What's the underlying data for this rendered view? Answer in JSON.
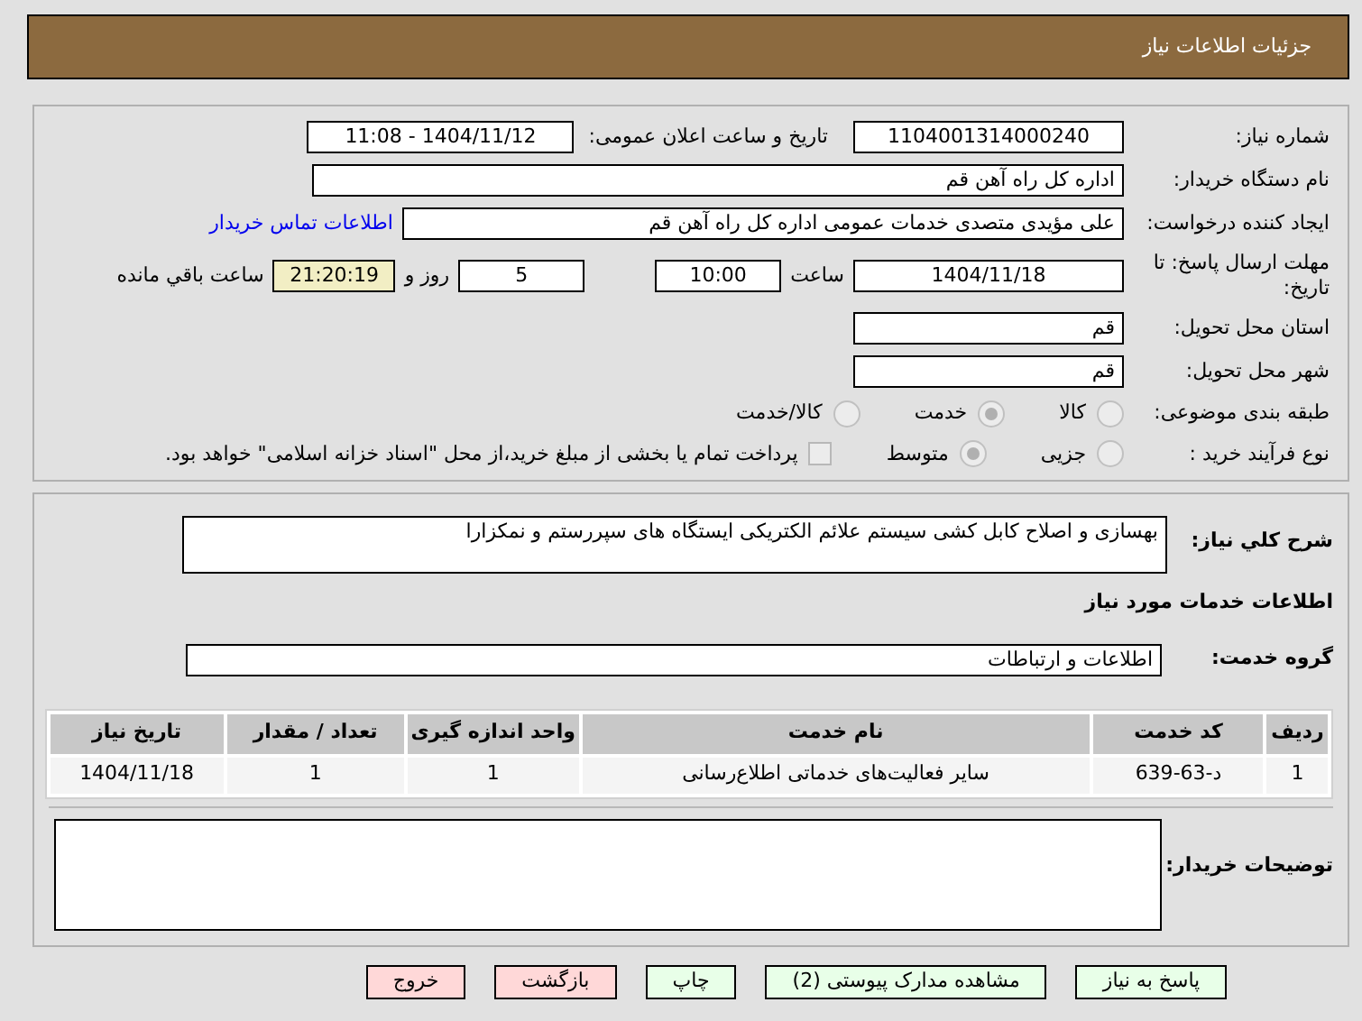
{
  "header": {
    "title": "جزئیات اطلاعات نیاز"
  },
  "fields": {
    "need_number": {
      "label": "شماره نیاز:",
      "value": "1104001314000240"
    },
    "announce": {
      "label": "تاریخ و ساعت اعلان عمومی:",
      "value": "1404/11/12 - 11:08"
    },
    "buyer": {
      "label": "نام دستگاه خریدار:",
      "value": "اداره کل  راه آهن قم"
    },
    "creator": {
      "label": "ایجاد کننده درخواست:",
      "value": "علی مؤیدی متصدی خدمات عمومی اداره کل  راه آهن قم",
      "link": "اطلاعات تماس خریدار"
    },
    "deadline": {
      "label": "مهلت ارسال پاسخ: تا تاریخ:",
      "date": "1404/11/18",
      "time_label": "ساعت",
      "time": "10:00",
      "days": "5",
      "days_label": "روز و",
      "remaining": "21:20:19",
      "remaining_label": "ساعت باقي مانده"
    },
    "province": {
      "label": "استان محل تحویل:",
      "value": "قم"
    },
    "city": {
      "label": "شهر محل تحویل:",
      "value": "قم"
    }
  },
  "category": {
    "label": "طبقه بندی موضوعی:",
    "options": [
      {
        "label": "کالا",
        "selected": false
      },
      {
        "label": "خدمت",
        "selected": true
      },
      {
        "label": "کالا/خدمت",
        "selected": false
      }
    ]
  },
  "process": {
    "label": "نوع فرآیند خرید :",
    "options": [
      {
        "label": "جزیی",
        "selected": false
      },
      {
        "label": "متوسط",
        "selected": true
      }
    ],
    "checkbox": {
      "checked": false,
      "label": "پرداخت تمام یا بخشی از مبلغ خرید،از محل \"اسناد خزانه اسلامی\" خواهد بود."
    }
  },
  "description": {
    "label": "شرح کلي نیاز:",
    "value": "بهسازی و اصلاح کابل کشی سیستم علائم الکتریکی ایستگاه های سپررستم و نمکزارا"
  },
  "services_title": "اطلاعات خدمات مورد نیاز",
  "service_group": {
    "label": "گروه خدمت:",
    "value": "اطلاعات و ارتباطات"
  },
  "table": {
    "columns": [
      "ردیف",
      "کد خدمت",
      "نام خدمت",
      "واحد اندازه گیری",
      "تعداد / مقدار",
      "تاریخ نیاز"
    ],
    "rows": [
      [
        "1",
        "د-63-639",
        "سایر فعالیت‌های خدماتی اطلاع‌رسانی",
        "1",
        "1",
        "1404/11/18"
      ]
    ]
  },
  "notes": {
    "label": "توضیحات خریدار:"
  },
  "buttons": [
    {
      "label": "پاسخ به نیاز",
      "kind": "primary"
    },
    {
      "label": "مشاهده مدارک پیوستی (2)",
      "kind": "primary"
    },
    {
      "label": "چاپ",
      "kind": "primary"
    },
    {
      "label": "بازگشت",
      "kind": "danger"
    },
    {
      "label": "خروج",
      "kind": "danger"
    }
  ]
}
